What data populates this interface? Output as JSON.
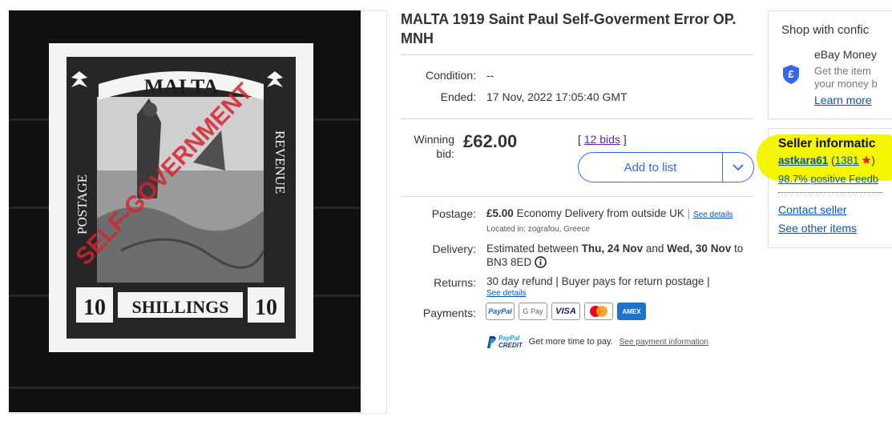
{
  "listing": {
    "title": "MALTA 1919 Saint Paul Self-Goverment Error OP. MNH",
    "condition_label": "Condition:",
    "condition_value": "--",
    "ended_label": "Ended:",
    "ended_value": "17 Nov, 2022 17:05:40 GMT"
  },
  "stamp": {
    "country": "MALTA",
    "left_text": "POSTAGE",
    "right_text": "REVENUE",
    "denomination": "10",
    "unit": "SHILLINGS",
    "overprint": "SELF-GOVERNMENT"
  },
  "bid": {
    "label_line1": "Winning",
    "label_line2": "bid:",
    "price": "£62.00",
    "bids_open": "[",
    "bids_text": "12 bids",
    "bids_close": "]",
    "add_to_list": "Add to list"
  },
  "shipping": {
    "postage_label": "Postage:",
    "postage_price": "£5.00",
    "postage_desc": "Economy Delivery from outside UK",
    "sep": "|",
    "see_details": "See details",
    "located": "Located in: zografou, Greece",
    "delivery_label": "Delivery:",
    "delivery_pre": "Estimated between",
    "delivery_from": "Thu, 24 Nov",
    "delivery_and": "and",
    "delivery_to": "Wed, 30 Nov",
    "delivery_post": "to",
    "delivery_postcode": "BN3 8ED",
    "returns_label": "Returns:",
    "returns_value": "30 day refund | Buyer pays for return postage |",
    "returns_details": "See details",
    "payments_label": "Payments:",
    "payment_methods": [
      "PayPal",
      "G Pay",
      "VISA",
      "",
      "AMEX"
    ],
    "credit_logo_top": "PayPal",
    "credit_logo_bottom": "CREDIT",
    "credit_text": "Get more time to pay.",
    "credit_link": "See payment information"
  },
  "shop_box": {
    "title": "Shop with confic",
    "guarantee_title": "eBay Money",
    "guarantee_line1": "Get the item",
    "guarantee_line2": "your money b",
    "learn_more": "Learn more",
    "icon_symbol": "£"
  },
  "seller": {
    "title": "Seller informatic",
    "name": "astkara61",
    "feedback_open": "(",
    "feedback_count": "1381",
    "feedback_close": ")",
    "feedback_pct": "98.7% positive Feedb",
    "contact": "Contact seller",
    "other_items": "See other items"
  },
  "colors": {
    "link": "#0654ba",
    "accent_blue": "#3665f3",
    "highlight": "#f4f500",
    "overprint_red": "#d8222e",
    "star_red": "#e4252f"
  }
}
